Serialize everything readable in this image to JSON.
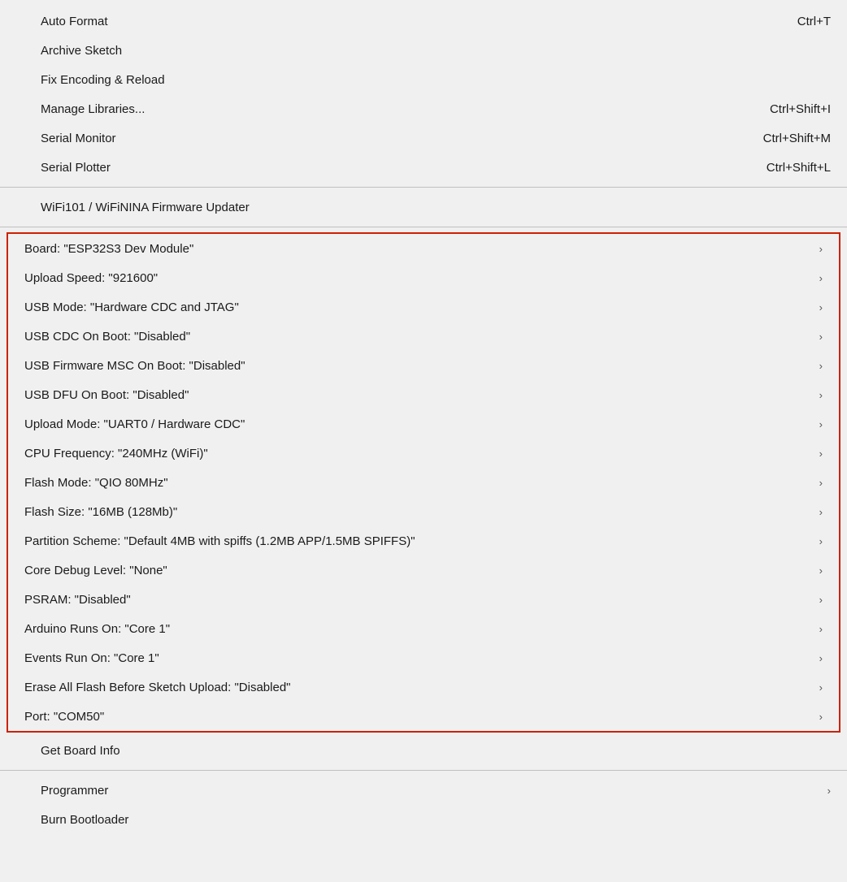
{
  "menu": {
    "items_top": [
      {
        "id": "auto-format",
        "label": "Auto Format",
        "shortcut": "Ctrl+T",
        "arrow": false
      },
      {
        "id": "archive-sketch",
        "label": "Archive Sketch",
        "shortcut": "",
        "arrow": false
      },
      {
        "id": "fix-encoding-reload",
        "label": "Fix Encoding & Reload",
        "shortcut": "",
        "arrow": false
      },
      {
        "id": "manage-libraries",
        "label": "Manage Libraries...",
        "shortcut": "Ctrl+Shift+I",
        "arrow": false
      },
      {
        "id": "serial-monitor",
        "label": "Serial Monitor",
        "shortcut": "Ctrl+Shift+M",
        "arrow": false
      },
      {
        "id": "serial-plotter",
        "label": "Serial Plotter",
        "shortcut": "Ctrl+Shift+L",
        "arrow": false
      }
    ],
    "items_wifi": [
      {
        "id": "wifi-firmware-updater",
        "label": "WiFi101 / WiFiNINA Firmware Updater",
        "shortcut": "",
        "arrow": false
      }
    ],
    "items_board_section": [
      {
        "id": "board",
        "label": "Board: \"ESP32S3 Dev Module\"",
        "shortcut": "",
        "arrow": true
      },
      {
        "id": "upload-speed",
        "label": "Upload Speed: \"921600\"",
        "shortcut": "",
        "arrow": true
      },
      {
        "id": "usb-mode",
        "label": "USB Mode: \"Hardware CDC and JTAG\"",
        "shortcut": "",
        "arrow": true
      },
      {
        "id": "usb-cdc-on-boot",
        "label": "USB CDC On Boot: \"Disabled\"",
        "shortcut": "",
        "arrow": true
      },
      {
        "id": "usb-firmware-msc-on-boot",
        "label": "USB Firmware MSC On Boot: \"Disabled\"",
        "shortcut": "",
        "arrow": true
      },
      {
        "id": "usb-dfu-on-boot",
        "label": "USB DFU On Boot: \"Disabled\"",
        "shortcut": "",
        "arrow": true
      },
      {
        "id": "upload-mode",
        "label": "Upload Mode: \"UART0 / Hardware CDC\"",
        "shortcut": "",
        "arrow": true
      },
      {
        "id": "cpu-frequency",
        "label": "CPU Frequency: \"240MHz (WiFi)\"",
        "shortcut": "",
        "arrow": true
      },
      {
        "id": "flash-mode",
        "label": "Flash Mode: \"QIO 80MHz\"",
        "shortcut": "",
        "arrow": true
      },
      {
        "id": "flash-size",
        "label": "Flash Size: \"16MB (128Mb)\"",
        "shortcut": "",
        "arrow": true
      },
      {
        "id": "partition-scheme",
        "label": "Partition Scheme: \"Default 4MB with spiffs (1.2MB APP/1.5MB SPIFFS)\"",
        "shortcut": "",
        "arrow": true
      },
      {
        "id": "core-debug-level",
        "label": "Core Debug Level: \"None\"",
        "shortcut": "",
        "arrow": true
      },
      {
        "id": "psram",
        "label": "PSRAM: \"Disabled\"",
        "shortcut": "",
        "arrow": true
      },
      {
        "id": "arduino-runs-on",
        "label": "Arduino Runs On: \"Core 1\"",
        "shortcut": "",
        "arrow": true
      },
      {
        "id": "events-run-on",
        "label": "Events Run On: \"Core 1\"",
        "shortcut": "",
        "arrow": true
      },
      {
        "id": "erase-all-flash",
        "label": "Erase All Flash Before Sketch Upload: \"Disabled\"",
        "shortcut": "",
        "arrow": true
      },
      {
        "id": "port",
        "label": "Port: \"COM50\"",
        "shortcut": "",
        "arrow": true
      }
    ],
    "items_bottom": [
      {
        "id": "get-board-info",
        "label": "Get Board Info",
        "shortcut": "",
        "arrow": false
      }
    ],
    "items_footer": [
      {
        "id": "programmer",
        "label": "Programmer",
        "shortcut": "",
        "arrow": true
      },
      {
        "id": "burn-bootloader",
        "label": "Burn Bootloader",
        "shortcut": "",
        "arrow": false
      }
    ]
  }
}
